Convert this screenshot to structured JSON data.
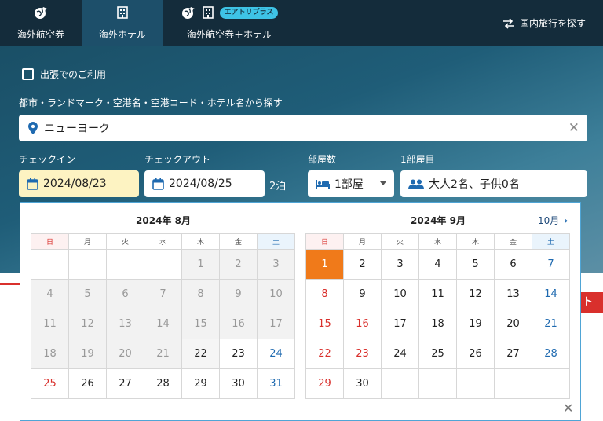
{
  "tabs": [
    {
      "label": "海外航空券",
      "icons": [
        "globe-plane-icon"
      ]
    },
    {
      "label": "海外ホテル",
      "icons": [
        "hotel-icon"
      ],
      "active": true
    },
    {
      "label": "海外航空券＋ホテル",
      "icons": [
        "globe-plane-icon",
        "hotel-icon"
      ],
      "badge": "エアトリプラス"
    }
  ],
  "domestic_link": "国内旅行を探す",
  "business_checkbox": "出張でのご利用",
  "search": {
    "label": "都市・ランドマーク・空港名・空港コード・ホテル名から探す",
    "value": "ニューヨーク"
  },
  "checkin": {
    "label": "チェックイン",
    "value": "2024/08/23"
  },
  "checkout": {
    "label": "チェックアウト",
    "value": "2024/08/25"
  },
  "nights": "2泊",
  "rooms": {
    "label": "部屋数",
    "value": "1部屋"
  },
  "guests": {
    "label": "1部屋目",
    "value": "大人2名、子供0名"
  },
  "calendar": {
    "weekdays": [
      "日",
      "月",
      "火",
      "水",
      "木",
      "金",
      "土"
    ],
    "next_month": "10月",
    "months": [
      {
        "title": "2024年 8月",
        "weeks": [
          [
            "",
            "",
            "",
            "",
            "1",
            "2",
            "3"
          ],
          [
            "4",
            "5",
            "6",
            "7",
            "8",
            "9",
            "10"
          ],
          [
            "11",
            "12",
            "13",
            "14",
            "15",
            "16",
            "17"
          ],
          [
            "18",
            "19",
            "20",
            "21",
            "22",
            "23",
            "24"
          ],
          [
            "25",
            "26",
            "27",
            "28",
            "29",
            "30",
            "31"
          ]
        ]
      },
      {
        "title": "2024年 9月",
        "weeks": [
          [
            "1",
            "2",
            "3",
            "4",
            "5",
            "6",
            "7"
          ],
          [
            "8",
            "9",
            "10",
            "11",
            "12",
            "13",
            "14"
          ],
          [
            "15",
            "16",
            "17",
            "18",
            "19",
            "20",
            "21"
          ],
          [
            "22",
            "23",
            "24",
            "25",
            "26",
            "27",
            "28"
          ],
          [
            "29",
            "30",
            "",
            "",
            "",
            "",
            ""
          ]
        ]
      }
    ]
  },
  "colors": {
    "selected": "#f07a1a",
    "sunday": "#d9302c",
    "saturday": "#1f6ab0",
    "checkin_bg": "#fdf3c2"
  }
}
